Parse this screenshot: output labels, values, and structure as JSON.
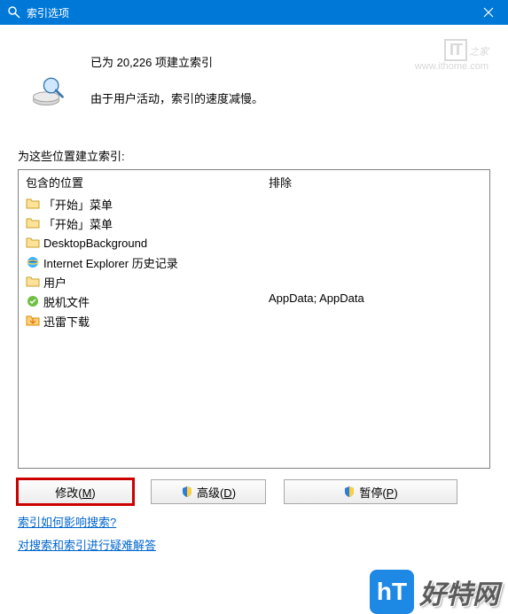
{
  "title": "索引选项",
  "status_line1": "已为 20,226 项建立索引",
  "status_line2": "由于用户活动，索引的速度减慢。",
  "label_locations": "为这些位置建立索引:",
  "columns": {
    "included": "包含的位置",
    "exclude": "排除"
  },
  "items": [
    {
      "label": "「开始」菜单",
      "icon": "folder"
    },
    {
      "label": "「开始」菜单",
      "icon": "folder"
    },
    {
      "label": "DesktopBackground",
      "icon": "folder"
    },
    {
      "label": "Internet Explorer 历史记录",
      "icon": "ie"
    },
    {
      "label": "用户",
      "icon": "folder"
    },
    {
      "label": "脱机文件",
      "icon": "offline"
    },
    {
      "label": "迅雷下载",
      "icon": "folder"
    }
  ],
  "exclude_text": "AppData; AppData",
  "buttons": {
    "modify_full": "修改(M)",
    "advanced_full": "高级(D)",
    "pause_full": "暂停(P)"
  },
  "link_how": "索引如何影响搜索?",
  "link_trouble": "对搜索和索引进行疑难解答",
  "watermark_url": "www.ithome.com",
  "brand": "好特网"
}
